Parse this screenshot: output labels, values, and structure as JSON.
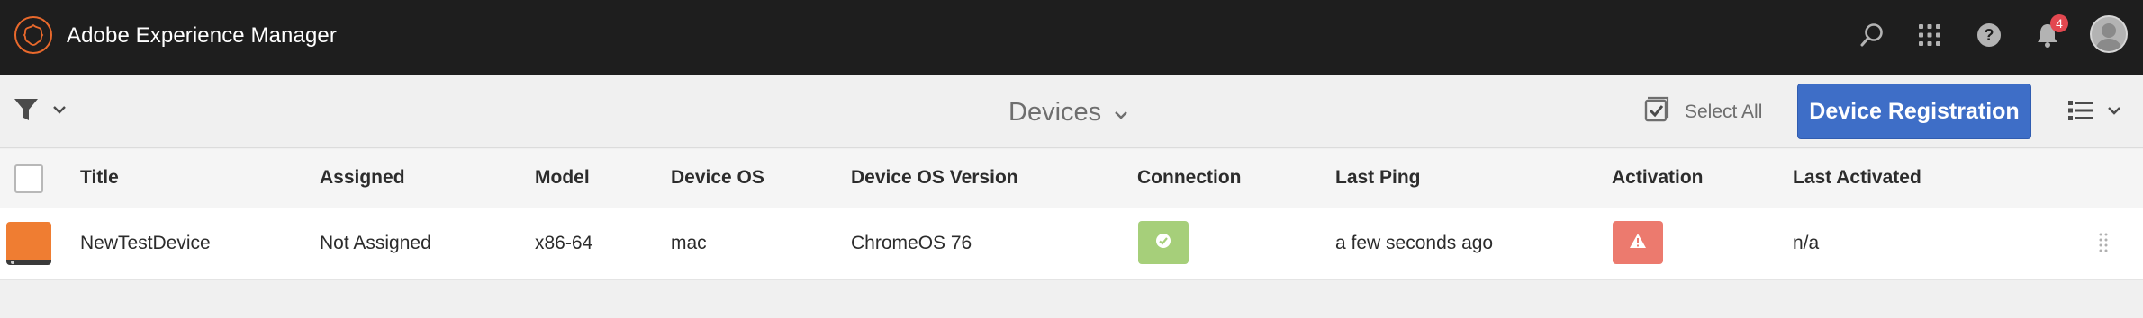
{
  "shell": {
    "title": "Adobe Experience Manager",
    "notification_count": "4",
    "icons": [
      "search-icon",
      "apps-grid-icon",
      "help-icon",
      "bell-icon",
      "user-avatar"
    ],
    "logo_color": "#e9692c"
  },
  "actionbar": {
    "title": "Devices",
    "select_all_label": "Select All",
    "primary_button_label": "Device Registration",
    "primary_color": "#3e6ec7"
  },
  "table": {
    "columns": [
      "Title",
      "Assigned",
      "Model",
      "Device OS",
      "Device OS Version",
      "Connection",
      "Last Ping",
      "Activation",
      "Last Activated"
    ],
    "rows": [
      {
        "title": "NewTestDevice",
        "assigned": "Not Assigned",
        "model": "x86-64",
        "device_os": "mac",
        "device_os_version": "ChromeOS 76",
        "connection": "ok",
        "last_ping": "a few seconds ago",
        "activation": "warning",
        "last_activated": "n/a"
      }
    ]
  },
  "colors": {
    "connection_ok": "#a6cf7a",
    "activation_warning": "#ec7a6e",
    "thumbnail": "#ef7d32"
  }
}
